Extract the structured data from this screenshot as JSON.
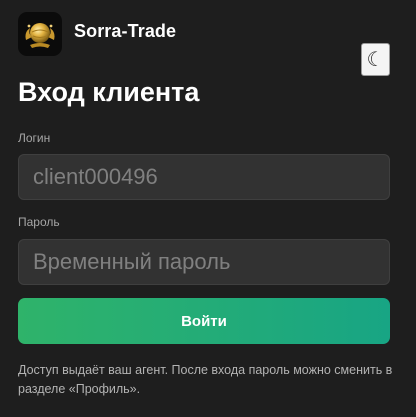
{
  "brand": {
    "name": "Sorra-Trade",
    "logo_icon": "golden-globe-dragon-icon"
  },
  "theme_toggle": {
    "icon": "crescent-moon-icon",
    "glyph": "☾"
  },
  "page_title": "Вход клиента",
  "login": {
    "label": "Логин",
    "placeholder": "client000496",
    "value": ""
  },
  "password": {
    "label": "Пароль",
    "placeholder": "Временный пароль",
    "value": ""
  },
  "submit_label": "Войти",
  "note": "Доступ выдаёт ваш агент. После входа пароль можно сменить в разделе «Профиль».",
  "colors": {
    "background": "#1e1e1e",
    "input_background": "#323232",
    "button_gradient_start": "#2fb36a",
    "button_gradient_end": "#18a584",
    "logo_gold": "#e3b341"
  }
}
